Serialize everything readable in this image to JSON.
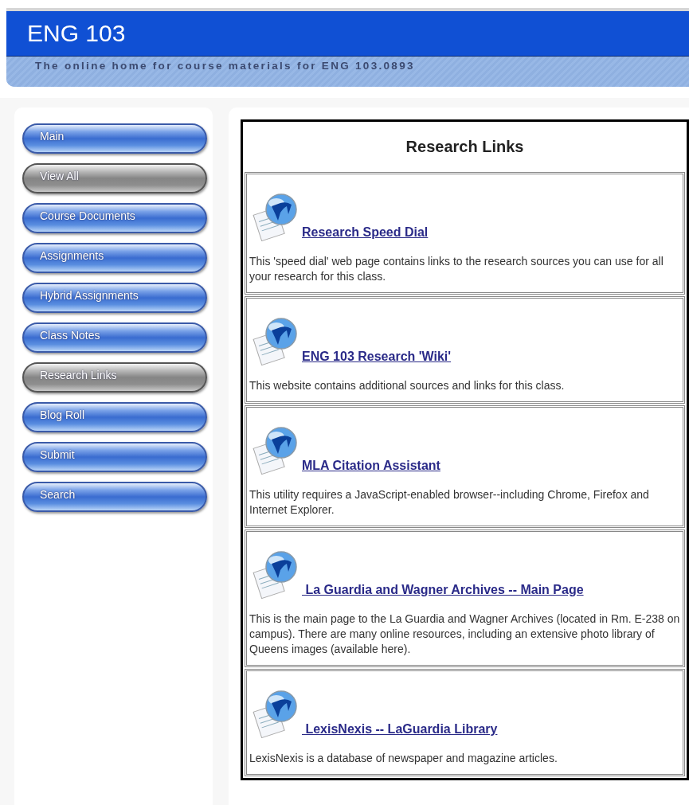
{
  "header": {
    "title": "ENG 103",
    "subtitle": "The online home for course materials for ENG 103.0893"
  },
  "sidebar": {
    "items": [
      {
        "label": "Main",
        "selected": false
      },
      {
        "label": "View All",
        "selected": true
      },
      {
        "label": "Course Documents",
        "selected": false
      },
      {
        "label": "Assignments",
        "selected": false
      },
      {
        "label": "Hybrid Assignments",
        "selected": false
      },
      {
        "label": "Class Notes",
        "selected": false
      },
      {
        "label": "Research Links",
        "selected": true
      },
      {
        "label": "Blog Roll",
        "selected": false
      },
      {
        "label": "Submit",
        "selected": false
      },
      {
        "label": "Search",
        "selected": false
      }
    ]
  },
  "content": {
    "title": "Research Links",
    "links": [
      {
        "title": "Research Speed Dial",
        "description": "This 'speed dial' web page contains links to the research sources you can use for all your research for this class."
      },
      {
        "title": "ENG 103 Research 'Wiki'",
        "description": "This website contains additional sources and links for this class."
      },
      {
        "title": "MLA Citation Assistant",
        "description": "This utility requires a JavaScript-enabled browser--including Chrome, Firefox and Internet Explorer."
      },
      {
        "title": " La Guardia and Wagner Archives -- Main Page",
        "description": "This is the main page to the La Guardia and Wagner Archives (located in Rm. E-238 on campus). There are many online resources, including an extensive photo library of Queens images (available here)."
      },
      {
        "title": " LexisNexis -- LaGuardia Library",
        "description": "LexisNexis is a database of newspaper and magazine articles."
      }
    ]
  }
}
